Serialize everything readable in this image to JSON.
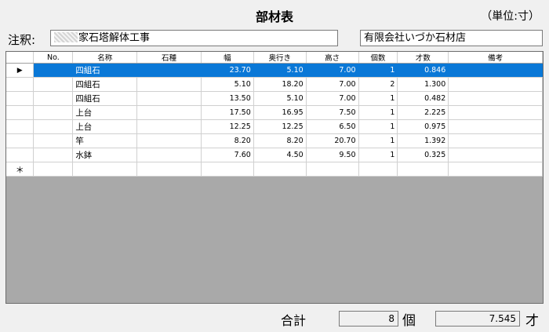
{
  "title": "部材表",
  "unit_label": "（単位:寸）",
  "note": {
    "label": "注釈:",
    "value": "家石塔解体工事"
  },
  "shop": "有限会社いづか石材店",
  "columns": [
    "No.",
    "名称",
    "石種",
    "幅",
    "奥行き",
    "高さ",
    "個数",
    "才数",
    "備考"
  ],
  "rows": [
    {
      "selector": "▶",
      "no": "",
      "name": "四組石",
      "stone": "",
      "width": "23.70",
      "depth": "5.10",
      "height": "7.00",
      "count": "1",
      "sai": "0.846",
      "remarks": ""
    },
    {
      "selector": "",
      "no": "",
      "name": "四組石",
      "stone": "",
      "width": "5.10",
      "depth": "18.20",
      "height": "7.00",
      "count": "2",
      "sai": "1.300",
      "remarks": ""
    },
    {
      "selector": "",
      "no": "",
      "name": "四組石",
      "stone": "",
      "width": "13.50",
      "depth": "5.10",
      "height": "7.00",
      "count": "1",
      "sai": "0.482",
      "remarks": ""
    },
    {
      "selector": "",
      "no": "",
      "name": "上台",
      "stone": "",
      "width": "17.50",
      "depth": "16.95",
      "height": "7.50",
      "count": "1",
      "sai": "2.225",
      "remarks": ""
    },
    {
      "selector": "",
      "no": "",
      "name": "上台",
      "stone": "",
      "width": "12.25",
      "depth": "12.25",
      "height": "6.50",
      "count": "1",
      "sai": "0.975",
      "remarks": ""
    },
    {
      "selector": "",
      "no": "",
      "name": "竿",
      "stone": "",
      "width": "8.20",
      "depth": "8.20",
      "height": "20.70",
      "count": "1",
      "sai": "1.392",
      "remarks": ""
    },
    {
      "selector": "",
      "no": "",
      "name": "水鉢",
      "stone": "",
      "width": "7.60",
      "depth": "4.50",
      "height": "9.50",
      "count": "1",
      "sai": "0.325",
      "remarks": ""
    }
  ],
  "new_row_marker": "＊",
  "footer": {
    "total_label": "合計",
    "count": "8",
    "count_unit": "個",
    "sai": "7.545",
    "sai_unit": "才"
  },
  "colors": {
    "selection": "#0a78d7",
    "empty_area": "#a9a9a9",
    "window_bg": "#f0f0f0"
  }
}
